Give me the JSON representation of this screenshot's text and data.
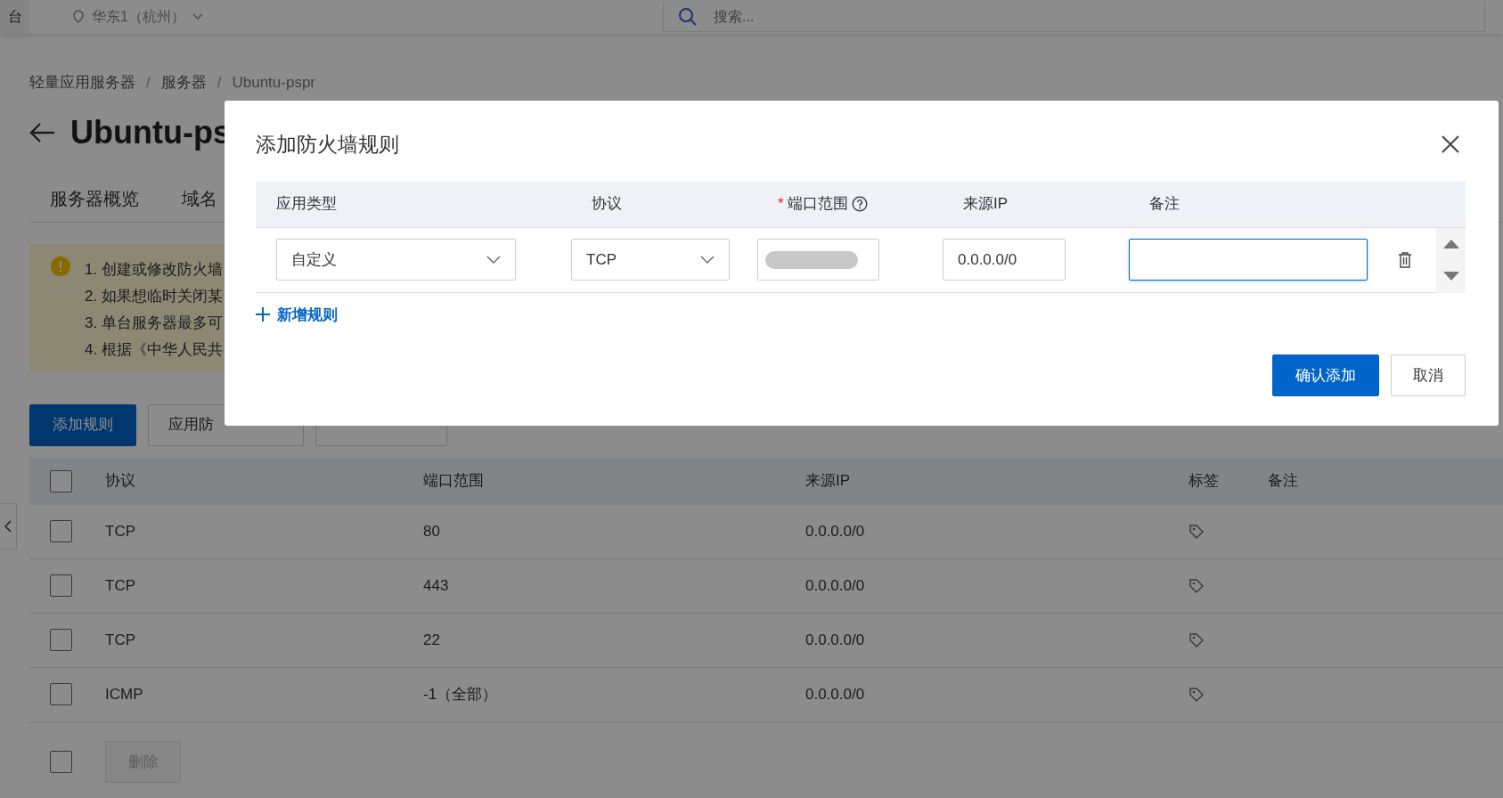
{
  "top_bar": {
    "left_text": "台",
    "region": "华东1（杭州）",
    "search": {
      "placeholder": "搜索..."
    }
  },
  "breadcrumb": {
    "items": [
      "轻量应用服务器",
      "服务器",
      "Ubuntu-pspr"
    ],
    "separator": "/"
  },
  "page_title": "Ubuntu-ps",
  "tabs": [
    {
      "label": "服务器概览",
      "selected": false
    },
    {
      "label": "域名",
      "selected": false
    }
  ],
  "notice": {
    "lines": [
      "1. 创建或修改防火墙",
      "2. 如果想临时关闭某",
      "3. 单台服务器最多可",
      "4. 根据《中华人民共"
    ]
  },
  "toolbar_buttons": [
    {
      "label": "添加规则",
      "kind": "primary"
    },
    {
      "label": "应用防",
      "kind": "default"
    },
    {
      "kind": "default"
    }
  ],
  "table": {
    "columns": [
      "协议",
      "端口范围",
      "来源IP",
      "标签",
      "备注"
    ],
    "header_checked": false,
    "rows": [
      {
        "protocol": "TCP",
        "port": "80",
        "source_ip": "0.0.0.0/0",
        "checked": false
      },
      {
        "protocol": "TCP",
        "port": "443",
        "source_ip": "0.0.0.0/0",
        "checked": false
      },
      {
        "protocol": "TCP",
        "port": "22",
        "source_ip": "0.0.0.0/0",
        "checked": false
      },
      {
        "protocol": "ICMP",
        "port": "-1（全部）",
        "source_ip": "0.0.0.0/0",
        "checked": false
      }
    ],
    "footer": {
      "checked": false,
      "delete_button": {
        "label": "删除",
        "disabled": true
      }
    }
  },
  "dialog": {
    "title": "添加防火墙规则",
    "columns": [
      {
        "label": "应用类型"
      },
      {
        "label": "协议"
      },
      {
        "label": "端口范围",
        "mark": "*",
        "help": true
      },
      {
        "label": "来源IP"
      },
      {
        "label": "备注"
      }
    ],
    "rules": [
      {
        "app_type": "自定义",
        "protocol": "TCP",
        "port_redacted": true,
        "source_ip": "0.0.0.0/0",
        "note_focused": true
      }
    ],
    "add_rule_link": "新增规则",
    "buttons": [
      {
        "label": "确认添加",
        "kind": "primary"
      },
      {
        "label": "取消",
        "kind": "default"
      }
    ]
  }
}
